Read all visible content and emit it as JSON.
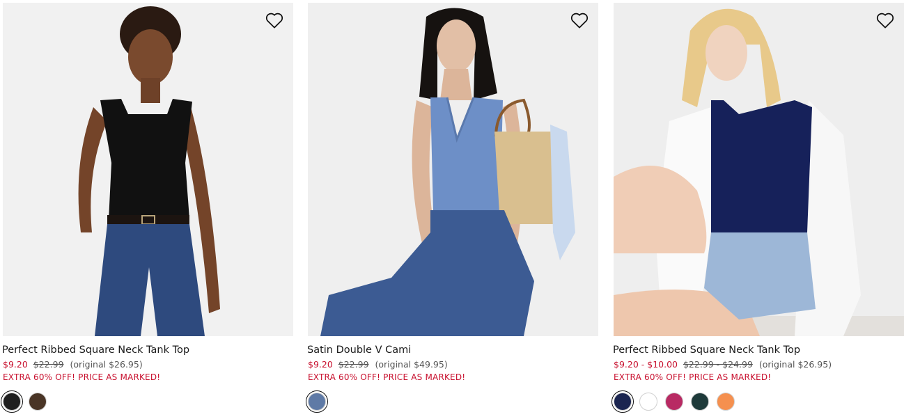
{
  "products": [
    {
      "name": "Perfect Ribbed Square Neck Tank Top",
      "sale_price": "$9.20",
      "was_price": "$22.99",
      "original_price": "(original $26.95)",
      "promo": "EXTRA 60% OFF! PRICE AS MARKED!",
      "swatches": [
        "#1f1f1f",
        "#4a3526"
      ],
      "bg": "#f1f1f1"
    },
    {
      "name": "Satin Double V Cami",
      "sale_price": "$9.20",
      "was_price": "$22.99",
      "original_price": "(original $49.95)",
      "promo": "EXTRA 60% OFF! PRICE AS MARKED!",
      "swatches": [
        "#5f7aa6"
      ],
      "bg": "#efefef"
    },
    {
      "name": "Perfect Ribbed Square Neck Tank Top",
      "sale_price": "$9.20 - $10.00",
      "was_price": "$22.99 - $24.99",
      "original_price": "(original $26.95)",
      "promo": "EXTRA 60% OFF! PRICE AS MARKED!",
      "swatches": [
        "#1b2550",
        "#ffffff",
        "#b82a63",
        "#1e3a3a",
        "#f5904f"
      ],
      "bg": "#eeeeee"
    }
  ],
  "icons": {
    "favorite": "heart-outline-icon"
  }
}
